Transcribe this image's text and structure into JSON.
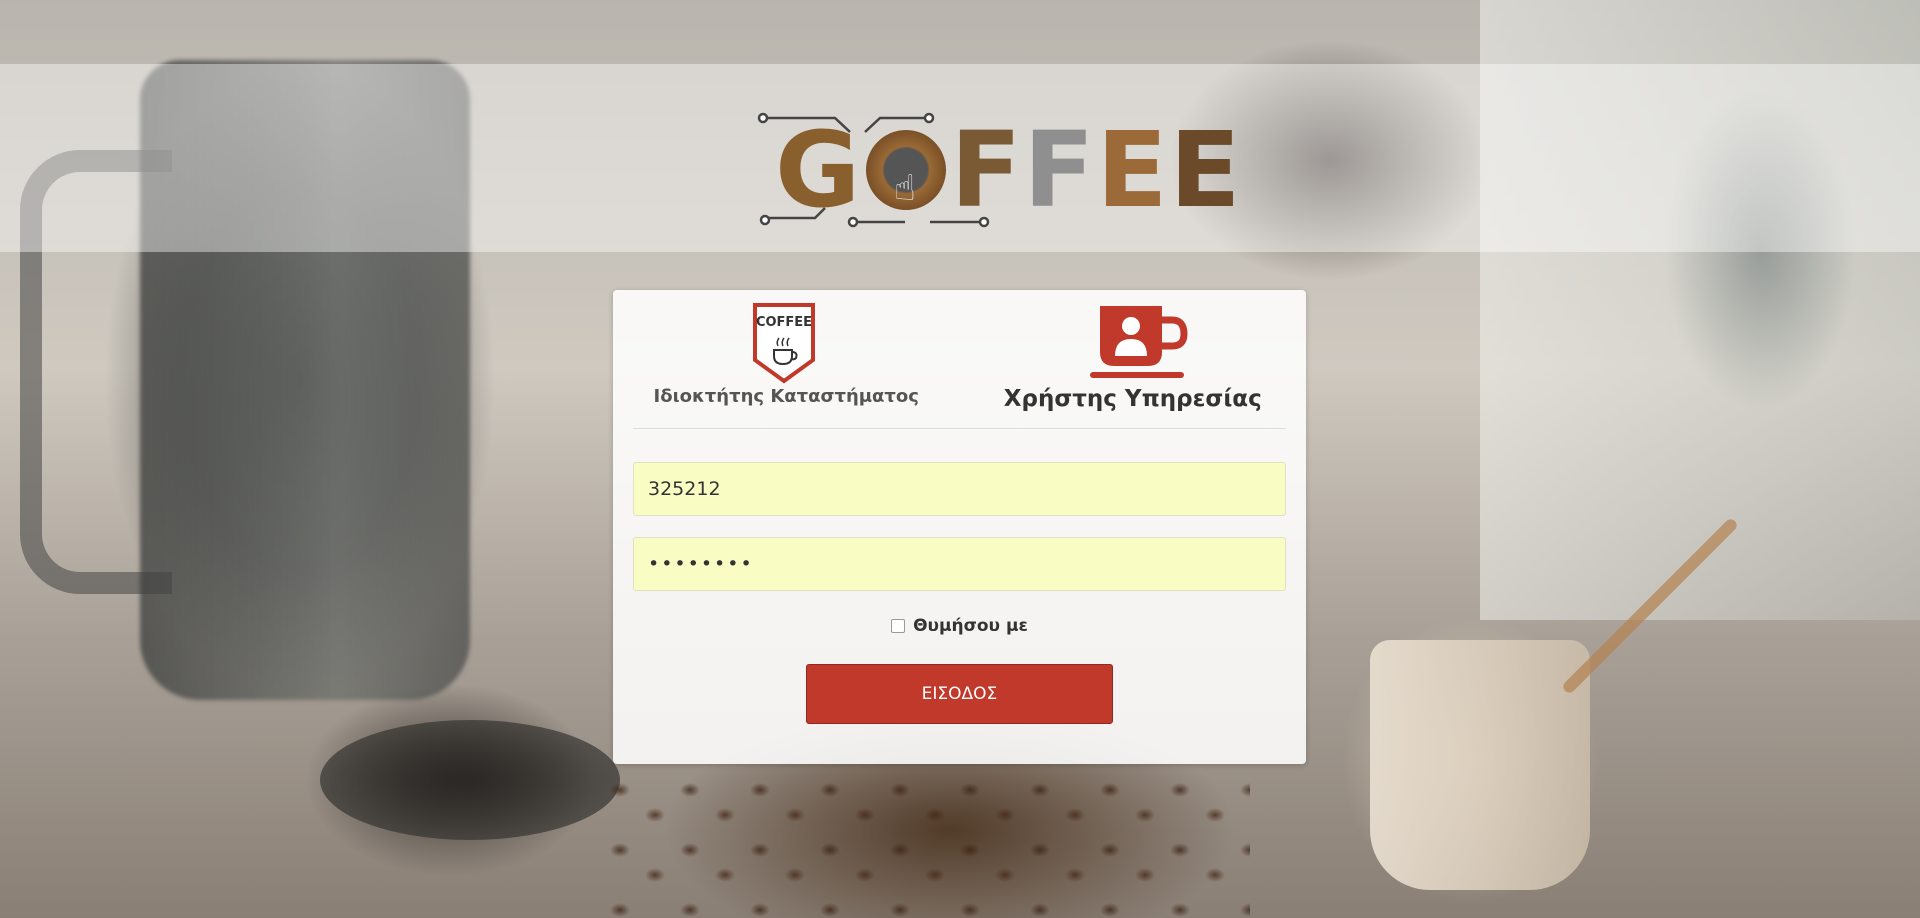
{
  "logo": {
    "letters": [
      "G",
      "F",
      "F",
      "E",
      "E"
    ],
    "colors": [
      "#8a5f2e",
      "#7a5a34",
      "#8f8f8f",
      "#9b6a38",
      "#6b4a2a"
    ]
  },
  "roles": {
    "owner": {
      "label": "Ιδιοκτήτης Καταστήματος",
      "badge_text": "COFFEE",
      "icon": "coffee-shield-icon"
    },
    "user": {
      "label": "Χρήστης Υπηρεσίας",
      "icon": "user-cup-icon"
    }
  },
  "form": {
    "username_value": "325212",
    "password_value": "••••••••",
    "remember_label": "Θυμήσου με",
    "remember_checked": false,
    "submit_label": "ΕΙΣΟΔΟΣ"
  },
  "colors": {
    "accent": "#c0392b",
    "field_fill": "#fafdc3"
  }
}
